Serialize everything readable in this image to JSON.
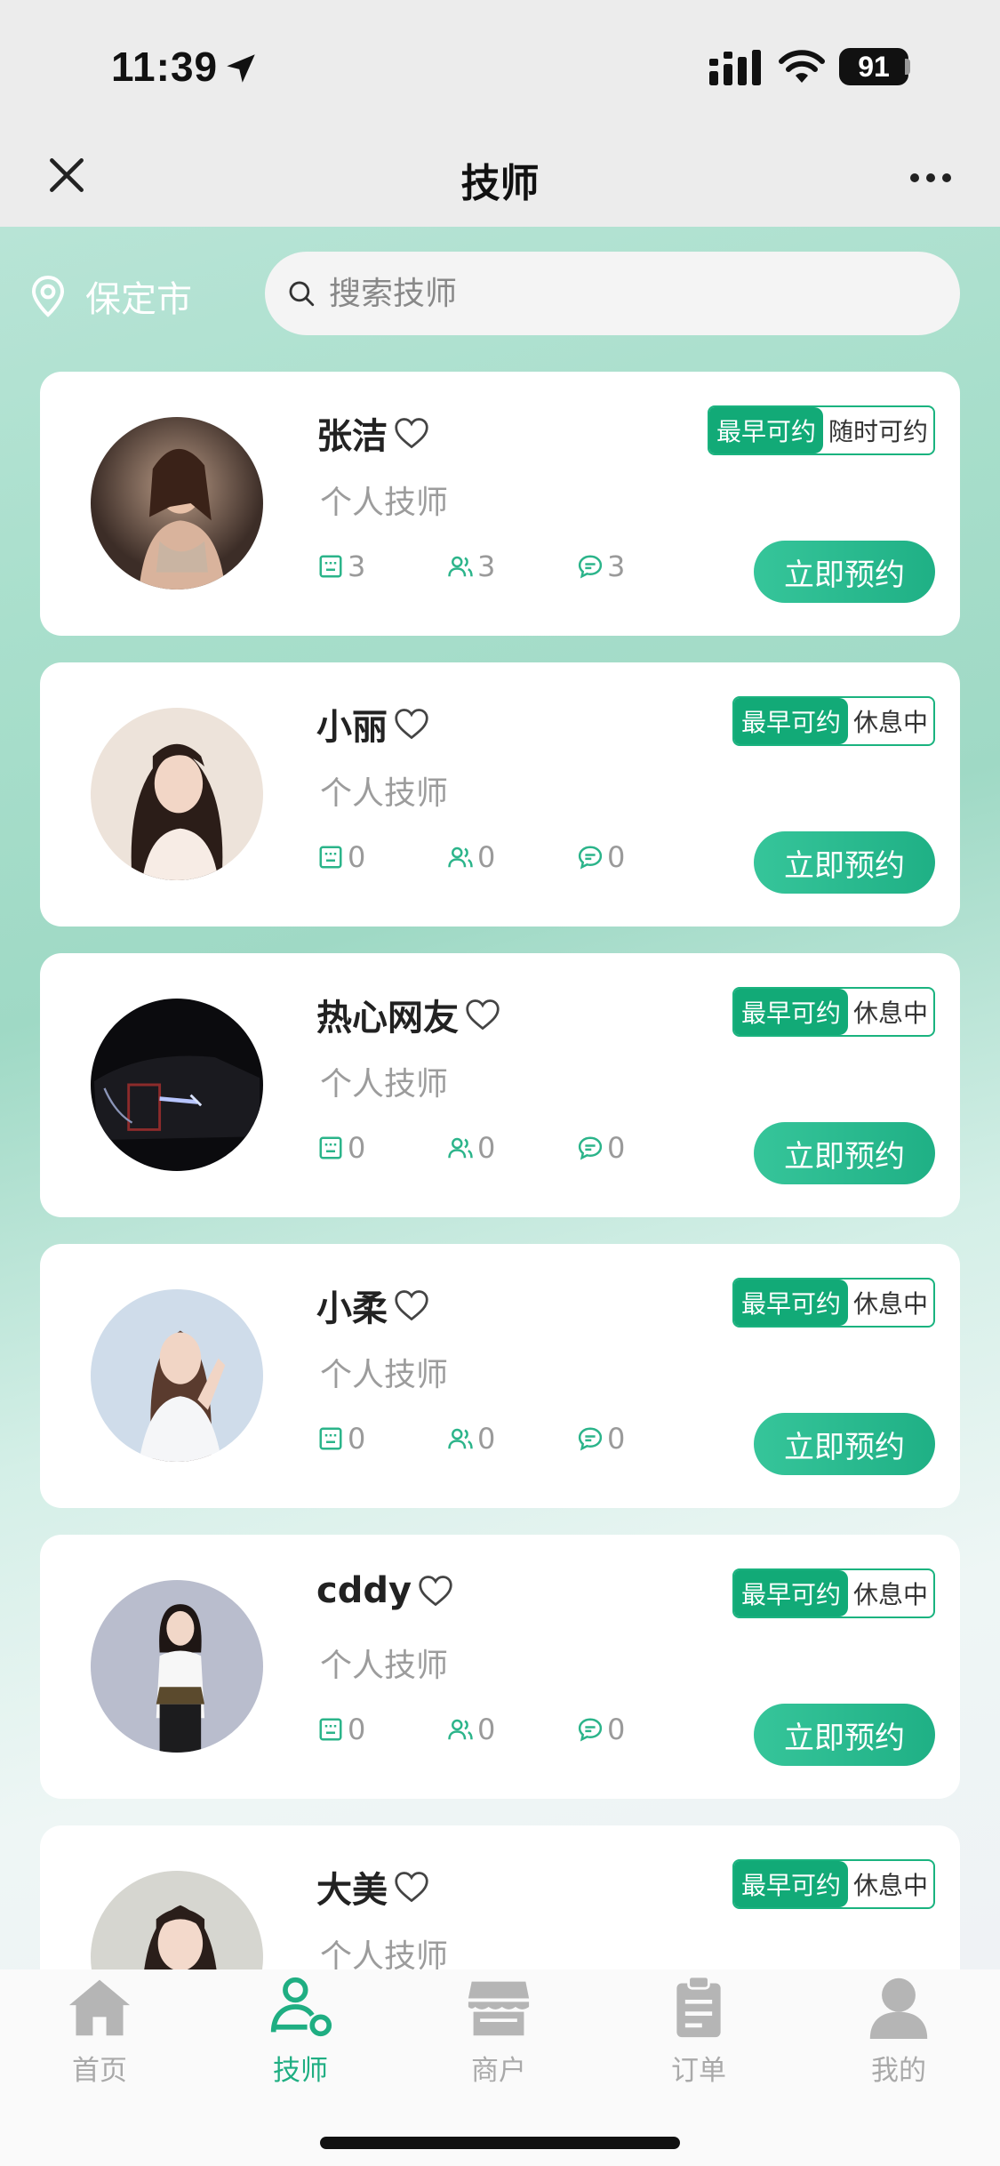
{
  "status_bar": {
    "time": "11:39",
    "battery": "91"
  },
  "nav": {
    "title": "技师"
  },
  "location": {
    "city": "保定市"
  },
  "search": {
    "placeholder": "搜索技师"
  },
  "technicians": [
    {
      "name": "张洁",
      "role": "个人技师",
      "tag_left": "最早可约",
      "tag_right": "随时可约",
      "orders": "3",
      "clients": "3",
      "comments": "3",
      "button": "立即预约"
    },
    {
      "name": "小丽",
      "role": "个人技师",
      "tag_left": "最早可约",
      "tag_right": "休息中",
      "orders": "0",
      "clients": "0",
      "comments": "0",
      "button": "立即预约"
    },
    {
      "name": "热心网友",
      "role": "个人技师",
      "tag_left": "最早可约",
      "tag_right": "休息中",
      "orders": "0",
      "clients": "0",
      "comments": "0",
      "button": "立即预约"
    },
    {
      "name": "小柔",
      "role": "个人技师",
      "tag_left": "最早可约",
      "tag_right": "休息中",
      "orders": "0",
      "clients": "0",
      "comments": "0",
      "button": "立即预约"
    },
    {
      "name": "cddy",
      "role": "个人技师",
      "tag_left": "最早可约",
      "tag_right": "休息中",
      "orders": "0",
      "clients": "0",
      "comments": "0",
      "button": "立即预约"
    },
    {
      "name": "大美",
      "role": "个人技师",
      "tag_left": "最早可约",
      "tag_right": "休息中"
    }
  ],
  "tabs": [
    {
      "label": "首页",
      "icon": "home-icon"
    },
    {
      "label": "技师",
      "icon": "technician-icon"
    },
    {
      "label": "商户",
      "icon": "store-icon"
    },
    {
      "label": "订单",
      "icon": "order-icon"
    },
    {
      "label": "我的",
      "icon": "user-icon"
    }
  ],
  "colors": {
    "accent": "#1fae82",
    "tab_inactive": "#a9a9a9"
  }
}
